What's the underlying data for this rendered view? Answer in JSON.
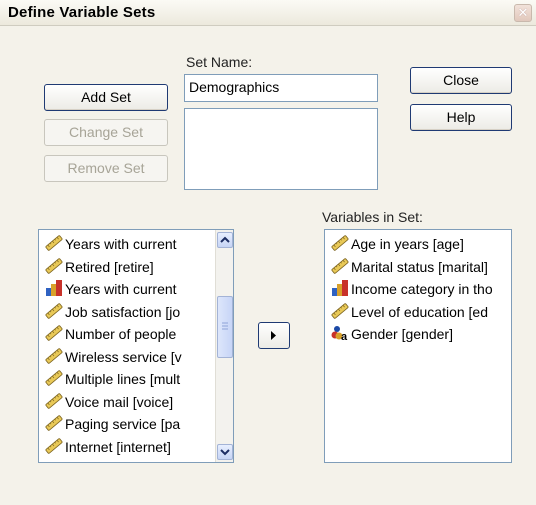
{
  "dialog": {
    "title": "Define Variable Sets"
  },
  "buttons": {
    "add_set": "Add Set",
    "change_set": "Change Set",
    "remove_set": "Remove Set",
    "close": "Close",
    "help": "Help"
  },
  "set_name": {
    "label": "Set Name:",
    "value": "Demographics"
  },
  "available_vars": {
    "items": [
      {
        "label": "Years with current",
        "icon": "scale-icon"
      },
      {
        "label": "Retired [retire]",
        "icon": "scale-icon"
      },
      {
        "label": "Years with current",
        "icon": "ordinal-icon"
      },
      {
        "label": "Job satisfaction [jo",
        "icon": "scale-icon"
      },
      {
        "label": "Number of people",
        "icon": "scale-icon"
      },
      {
        "label": "Wireless service [v",
        "icon": "scale-icon"
      },
      {
        "label": "Multiple lines [mult",
        "icon": "scale-icon"
      },
      {
        "label": "Voice mail [voice]",
        "icon": "scale-icon"
      },
      {
        "label": "Paging service [pa",
        "icon": "scale-icon"
      },
      {
        "label": "Internet [internet]",
        "icon": "scale-icon"
      }
    ]
  },
  "set_vars": {
    "label": "Variables in Set:",
    "items": [
      {
        "label": "Age in years [age]",
        "icon": "scale-icon"
      },
      {
        "label": "Marital status [marital]",
        "icon": "scale-icon"
      },
      {
        "label": "Income category in tho",
        "icon": "ordinal-icon"
      },
      {
        "label": "Level of education [ed",
        "icon": "scale-icon"
      },
      {
        "label": "Gender [gender]",
        "icon": "nominal-string-icon"
      }
    ]
  }
}
